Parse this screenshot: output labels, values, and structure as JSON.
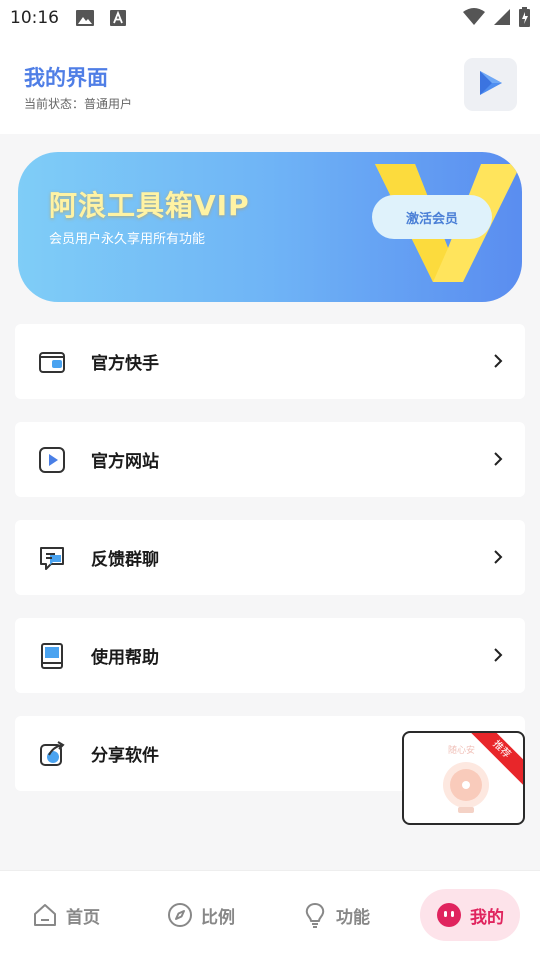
{
  "status_bar": {
    "time": "10:16",
    "icons": [
      "image-icon",
      "a-icon",
      "wifi-icon",
      "signal-icon",
      "battery-icon"
    ]
  },
  "header": {
    "title": "我的界面",
    "status_label": "当前状态：",
    "status_value": "普通用户",
    "action_icon": "play-icon"
  },
  "vip_banner": {
    "title": "阿浪工具箱VIP",
    "subtitle": "会员用户永久享用所有功能",
    "button_label": "激活会员",
    "badge_letter": "V"
  },
  "menu": [
    {
      "label": "官方快手",
      "icon": "wallet-icon"
    },
    {
      "label": "官方网站",
      "icon": "video-icon"
    },
    {
      "label": "反馈群聊",
      "icon": "chat-icon"
    },
    {
      "label": "使用帮助",
      "icon": "book-icon"
    },
    {
      "label": "分享软件",
      "icon": "share-icon"
    }
  ],
  "float_ad": {
    "ribbon": "推荐",
    "caption": "随心安"
  },
  "bottom_nav": [
    {
      "label": "首页",
      "icon": "home-icon",
      "active": false
    },
    {
      "label": "比例",
      "icon": "compass-icon",
      "active": false
    },
    {
      "label": "功能",
      "icon": "bulb-icon",
      "active": false
    },
    {
      "label": "我的",
      "icon": "profile-face-icon",
      "active": true
    }
  ],
  "colors": {
    "accent": "#4f7ee6",
    "active_tab": "#e0245e",
    "active_tab_bg": "#fde3ea"
  }
}
